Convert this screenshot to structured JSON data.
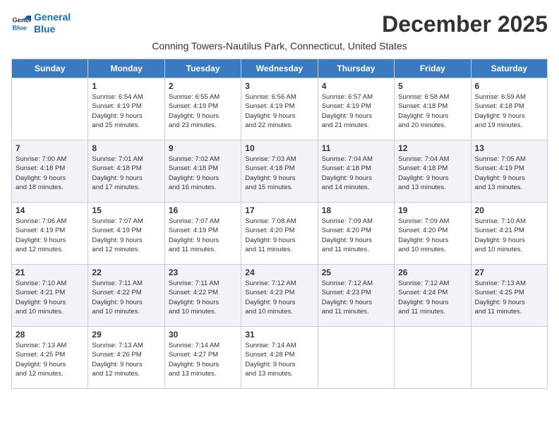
{
  "header": {
    "logo_line1": "General",
    "logo_line2": "Blue",
    "month_title": "December 2025",
    "subtitle": "Conning Towers-Nautilus Park, Connecticut, United States"
  },
  "weekdays": [
    "Sunday",
    "Monday",
    "Tuesday",
    "Wednesday",
    "Thursday",
    "Friday",
    "Saturday"
  ],
  "weeks": [
    [
      {
        "day": "",
        "info": ""
      },
      {
        "day": "1",
        "info": "Sunrise: 6:54 AM\nSunset: 4:19 PM\nDaylight: 9 hours\nand 25 minutes."
      },
      {
        "day": "2",
        "info": "Sunrise: 6:55 AM\nSunset: 4:19 PM\nDaylight: 9 hours\nand 23 minutes."
      },
      {
        "day": "3",
        "info": "Sunrise: 6:56 AM\nSunset: 4:19 PM\nDaylight: 9 hours\nand 22 minutes."
      },
      {
        "day": "4",
        "info": "Sunrise: 6:57 AM\nSunset: 4:19 PM\nDaylight: 9 hours\nand 21 minutes."
      },
      {
        "day": "5",
        "info": "Sunrise: 6:58 AM\nSunset: 4:18 PM\nDaylight: 9 hours\nand 20 minutes."
      },
      {
        "day": "6",
        "info": "Sunrise: 6:59 AM\nSunset: 4:18 PM\nDaylight: 9 hours\nand 19 minutes."
      }
    ],
    [
      {
        "day": "7",
        "info": "Sunrise: 7:00 AM\nSunset: 4:18 PM\nDaylight: 9 hours\nand 18 minutes."
      },
      {
        "day": "8",
        "info": "Sunrise: 7:01 AM\nSunset: 4:18 PM\nDaylight: 9 hours\nand 17 minutes."
      },
      {
        "day": "9",
        "info": "Sunrise: 7:02 AM\nSunset: 4:18 PM\nDaylight: 9 hours\nand 16 minutes."
      },
      {
        "day": "10",
        "info": "Sunrise: 7:03 AM\nSunset: 4:18 PM\nDaylight: 9 hours\nand 15 minutes."
      },
      {
        "day": "11",
        "info": "Sunrise: 7:04 AM\nSunset: 4:18 PM\nDaylight: 9 hours\nand 14 minutes."
      },
      {
        "day": "12",
        "info": "Sunrise: 7:04 AM\nSunset: 4:18 PM\nDaylight: 9 hours\nand 13 minutes."
      },
      {
        "day": "13",
        "info": "Sunrise: 7:05 AM\nSunset: 4:19 PM\nDaylight: 9 hours\nand 13 minutes."
      }
    ],
    [
      {
        "day": "14",
        "info": "Sunrise: 7:06 AM\nSunset: 4:19 PM\nDaylight: 9 hours\nand 12 minutes."
      },
      {
        "day": "15",
        "info": "Sunrise: 7:07 AM\nSunset: 4:19 PM\nDaylight: 9 hours\nand 12 minutes."
      },
      {
        "day": "16",
        "info": "Sunrise: 7:07 AM\nSunset: 4:19 PM\nDaylight: 9 hours\nand 11 minutes."
      },
      {
        "day": "17",
        "info": "Sunrise: 7:08 AM\nSunset: 4:20 PM\nDaylight: 9 hours\nand 11 minutes."
      },
      {
        "day": "18",
        "info": "Sunrise: 7:09 AM\nSunset: 4:20 PM\nDaylight: 9 hours\nand 11 minutes."
      },
      {
        "day": "19",
        "info": "Sunrise: 7:09 AM\nSunset: 4:20 PM\nDaylight: 9 hours\nand 10 minutes."
      },
      {
        "day": "20",
        "info": "Sunrise: 7:10 AM\nSunset: 4:21 PM\nDaylight: 9 hours\nand 10 minutes."
      }
    ],
    [
      {
        "day": "21",
        "info": "Sunrise: 7:10 AM\nSunset: 4:21 PM\nDaylight: 9 hours\nand 10 minutes."
      },
      {
        "day": "22",
        "info": "Sunrise: 7:11 AM\nSunset: 4:22 PM\nDaylight: 9 hours\nand 10 minutes."
      },
      {
        "day": "23",
        "info": "Sunrise: 7:11 AM\nSunset: 4:22 PM\nDaylight: 9 hours\nand 10 minutes."
      },
      {
        "day": "24",
        "info": "Sunrise: 7:12 AM\nSunset: 4:23 PM\nDaylight: 9 hours\nand 10 minutes."
      },
      {
        "day": "25",
        "info": "Sunrise: 7:12 AM\nSunset: 4:23 PM\nDaylight: 9 hours\nand 11 minutes."
      },
      {
        "day": "26",
        "info": "Sunrise: 7:12 AM\nSunset: 4:24 PM\nDaylight: 9 hours\nand 11 minutes."
      },
      {
        "day": "27",
        "info": "Sunrise: 7:13 AM\nSunset: 4:25 PM\nDaylight: 9 hours\nand 11 minutes."
      }
    ],
    [
      {
        "day": "28",
        "info": "Sunrise: 7:13 AM\nSunset: 4:25 PM\nDaylight: 9 hours\nand 12 minutes."
      },
      {
        "day": "29",
        "info": "Sunrise: 7:13 AM\nSunset: 4:26 PM\nDaylight: 9 hours\nand 12 minutes."
      },
      {
        "day": "30",
        "info": "Sunrise: 7:14 AM\nSunset: 4:27 PM\nDaylight: 9 hours\nand 13 minutes."
      },
      {
        "day": "31",
        "info": "Sunrise: 7:14 AM\nSunset: 4:28 PM\nDaylight: 9 hours\nand 13 minutes."
      },
      {
        "day": "",
        "info": ""
      },
      {
        "day": "",
        "info": ""
      },
      {
        "day": "",
        "info": ""
      }
    ]
  ]
}
